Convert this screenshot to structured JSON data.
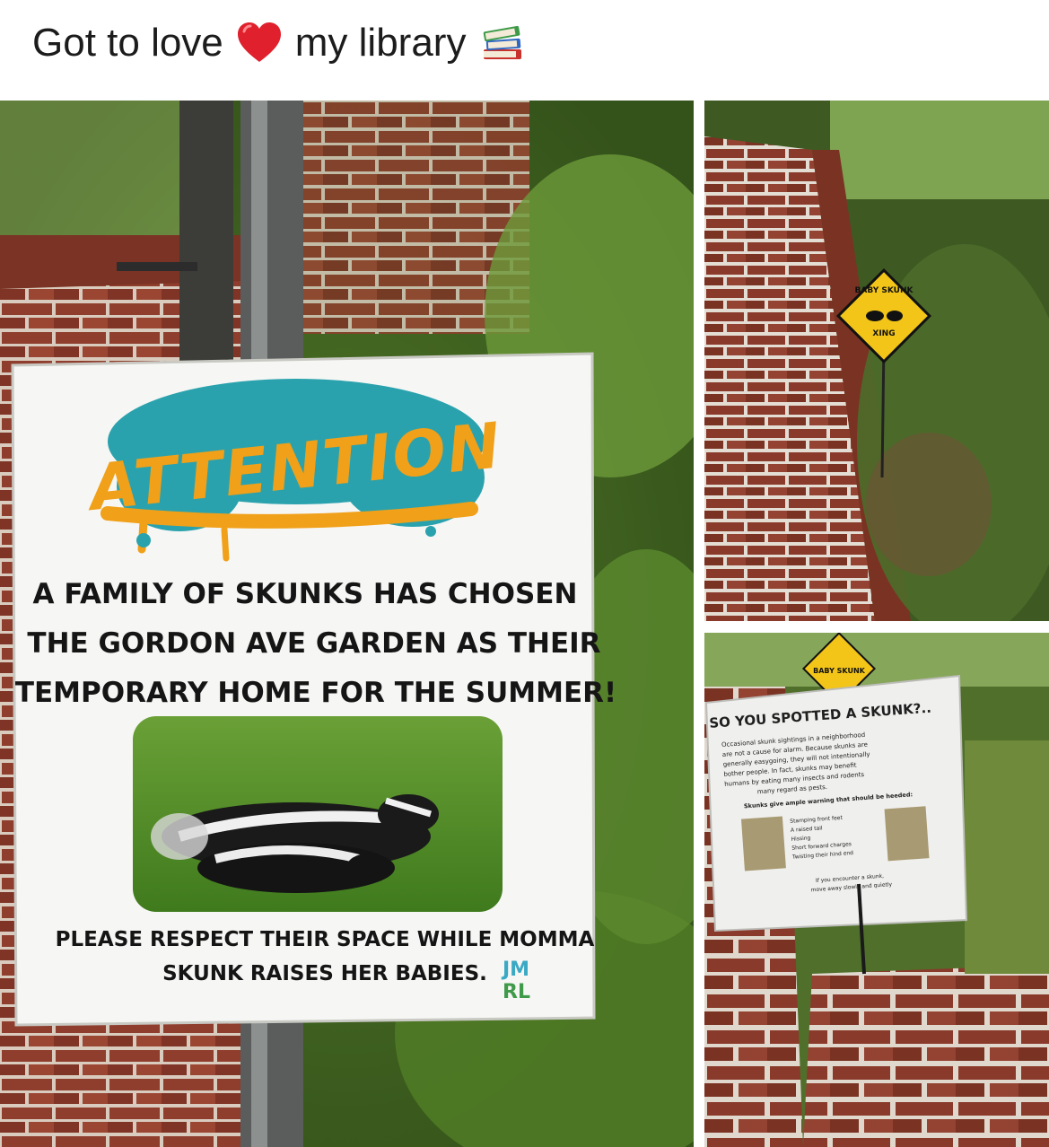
{
  "post": {
    "caption_before": "Got to love",
    "caption_after": "my library",
    "heart_icon": "red-heart-emoji",
    "books_icon": "stack-of-books-emoji"
  },
  "main_sign": {
    "heading": "ATTENTION",
    "line1": "A FAMILY OF SKUNKS HAS CHOSEN",
    "line2": "THE GORDON AVE GARDEN AS THEIR",
    "line3": "TEMPORARY HOME FOR THE SUMMER!",
    "footer1": "PLEASE RESPECT THEIR SPACE WHILE MOMMA",
    "footer2": "SKUNK RAISES HER BABIES.",
    "logo_top": "JM",
    "logo_bottom": "RL"
  },
  "xing_sign": {
    "top": "BABY SKUNK",
    "bottom": "XING"
  },
  "info_sign": {
    "corner_sign": "BABY SKUNK",
    "title": "SO YOU SPOTTED A SKUNK?..",
    "para1": "Occasional skunk sightings in a neighborhood",
    "para2": "are not a cause for alarm. Because skunks are",
    "para3": "generally easygoing, they will not intentionally",
    "para4": "bother people. In fact, skunks may benefit",
    "para5": "humans by eating many insects and rodents",
    "para6": "many regard as pests.",
    "warning": "Skunks give ample warning that should be heeded:",
    "bullet1": "Stamping front feet",
    "bullet2": "A raised tail",
    "bullet3": "Hissing",
    "bullet4": "Short forward charges",
    "bullet5": "Twisting their hind end",
    "closing1": "If you encounter a skunk,",
    "closing2": "move away slowly and quietly"
  }
}
